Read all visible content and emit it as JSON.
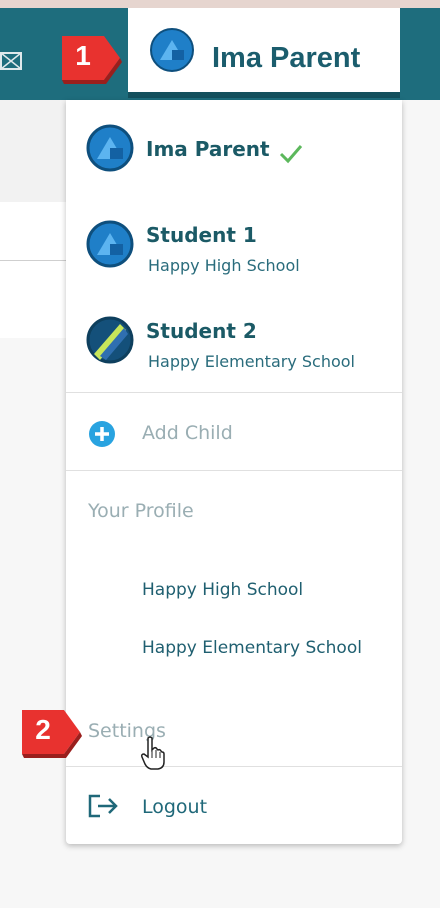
{
  "header": {
    "current_user_name": "Ima Parent"
  },
  "callouts": [
    "1",
    "2"
  ],
  "dropdown": {
    "accounts": [
      {
        "name": "Ima Parent",
        "school": "",
        "selected": true
      },
      {
        "name": "Student 1",
        "school": "Happy High School",
        "selected": false
      },
      {
        "name": "Student 2",
        "school": "Happy Elementary School",
        "selected": false
      }
    ],
    "add_child_label": "Add Child",
    "your_profile_label": "Your Profile",
    "profile_schools": [
      "Happy High School",
      "Happy Elementary School"
    ],
    "settings_label": "Settings",
    "logout_label": "Logout"
  },
  "colors": {
    "header_bg": "#1e6d7d",
    "accent_teal": "#1b5d6d",
    "callout_red": "#e8322f",
    "check_green": "#5cb85c",
    "add_icon_blue": "#29a3e0"
  },
  "icons": [
    "mail-icon",
    "avatar-icon",
    "checkmark-icon",
    "add-circle-icon",
    "logout-icon",
    "hand-cursor-icon"
  ]
}
